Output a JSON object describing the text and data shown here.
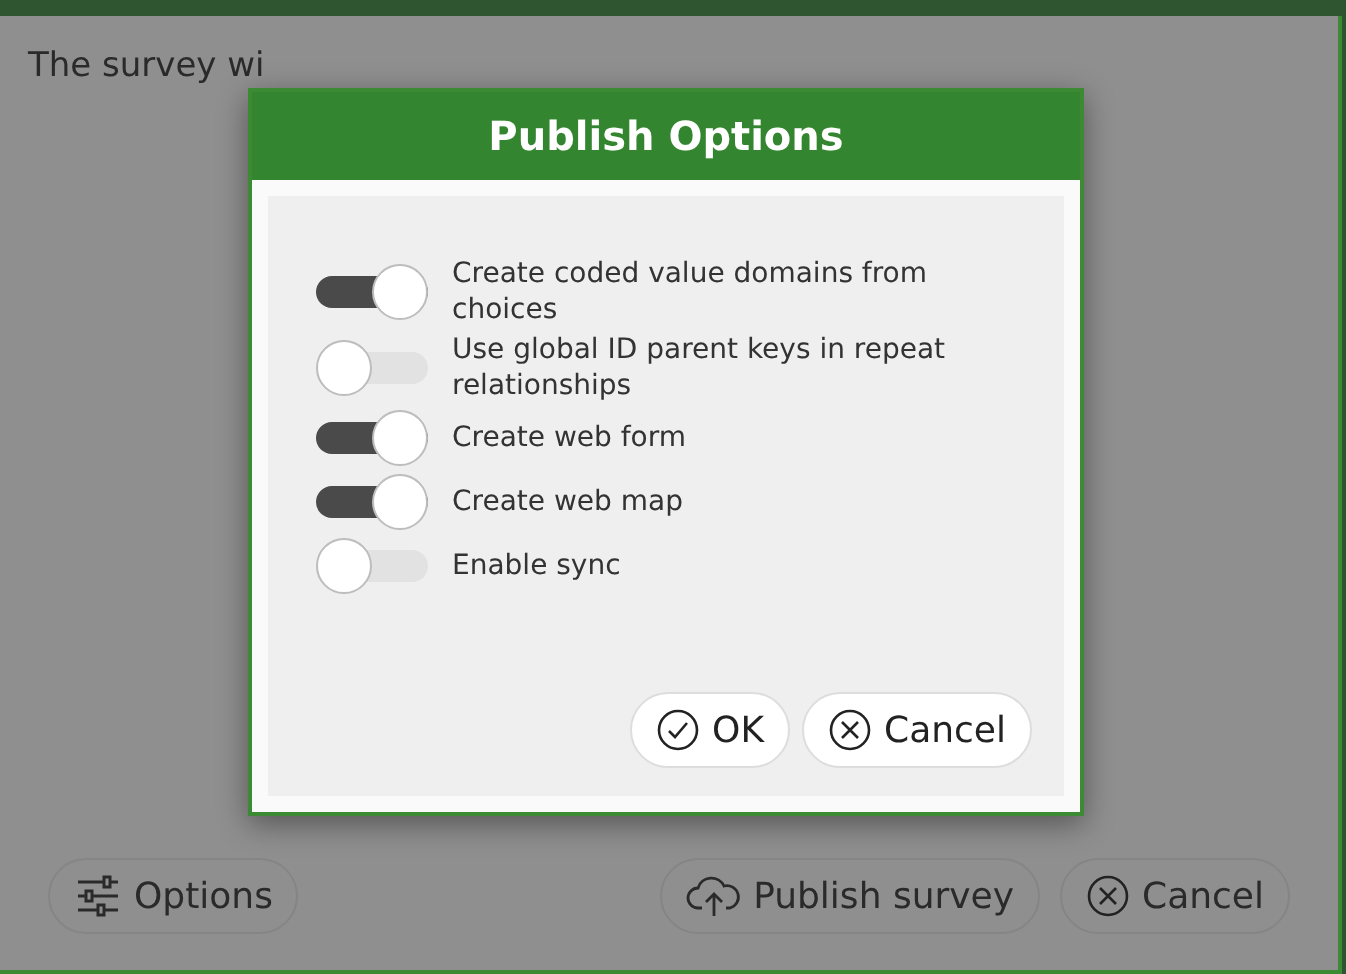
{
  "page": {
    "message": "The survey wi",
    "buttons": [
      {
        "kind": "options",
        "label": "Options"
      },
      {
        "kind": "publish",
        "label": "Publish survey"
      },
      {
        "kind": "cancel",
        "label": "Cancel"
      }
    ]
  },
  "dialog": {
    "title": "Publish Options",
    "options": [
      {
        "label": "Create coded value domains from choices",
        "on": true
      },
      {
        "label": "Use global ID parent keys in repeat relationships",
        "on": false
      },
      {
        "label": "Create web form",
        "on": true
      },
      {
        "label": "Create web map",
        "on": true
      },
      {
        "label": "Enable sync",
        "on": false
      }
    ],
    "buttons": [
      {
        "kind": "ok",
        "label": "OK"
      },
      {
        "kind": "cancel",
        "label": "Cancel"
      }
    ]
  }
}
